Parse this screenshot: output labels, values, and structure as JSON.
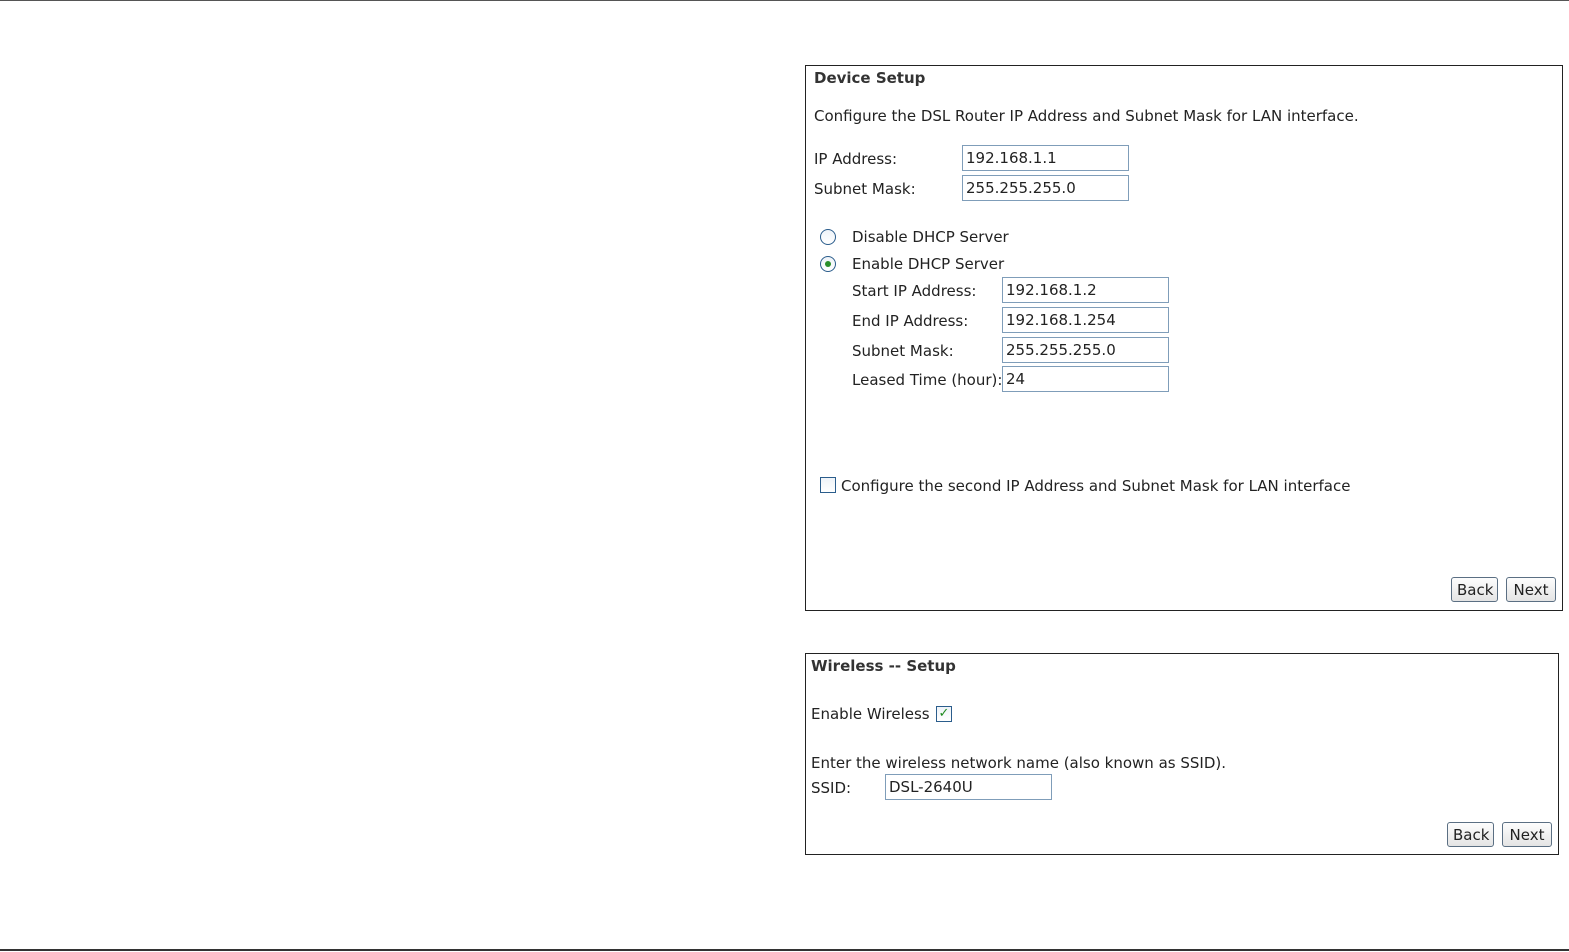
{
  "device_setup": {
    "title": "Device Setup",
    "description": "Configure the DSL Router IP Address and Subnet Mask for LAN interface.",
    "ip_address_label": "IP Address:",
    "ip_address_value": "192.168.1.1",
    "subnet_mask_label": "Subnet Mask:",
    "subnet_mask_value": "255.255.255.0",
    "dhcp_options": [
      {
        "label": "Disable DHCP Server",
        "selected": false
      },
      {
        "label": "Enable DHCP Server",
        "selected": true
      }
    ],
    "dhcp": {
      "start_ip_label": "Start IP Address:",
      "start_ip_value": "192.168.1.2",
      "end_ip_label": "End IP Address:",
      "end_ip_value": "192.168.1.254",
      "subnet_mask_label": "Subnet Mask:",
      "subnet_mask_value": "255.255.255.0",
      "lease_time_label": "Leased Time (hour):",
      "lease_time_value": "24"
    },
    "second_ip_label": "Configure the second IP Address and Subnet Mask for LAN interface",
    "second_ip_checked": false,
    "back_label": "Back",
    "next_label": "Next"
  },
  "wireless_setup": {
    "title": "Wireless -- Setup",
    "enable_label": "Enable Wireless",
    "enable_checked": true,
    "ssid_description": "Enter the wireless network name (also known as SSID).",
    "ssid_label": "SSID:",
    "ssid_value": "DSL-2640U",
    "back_label": "Back",
    "next_label": "Next"
  }
}
